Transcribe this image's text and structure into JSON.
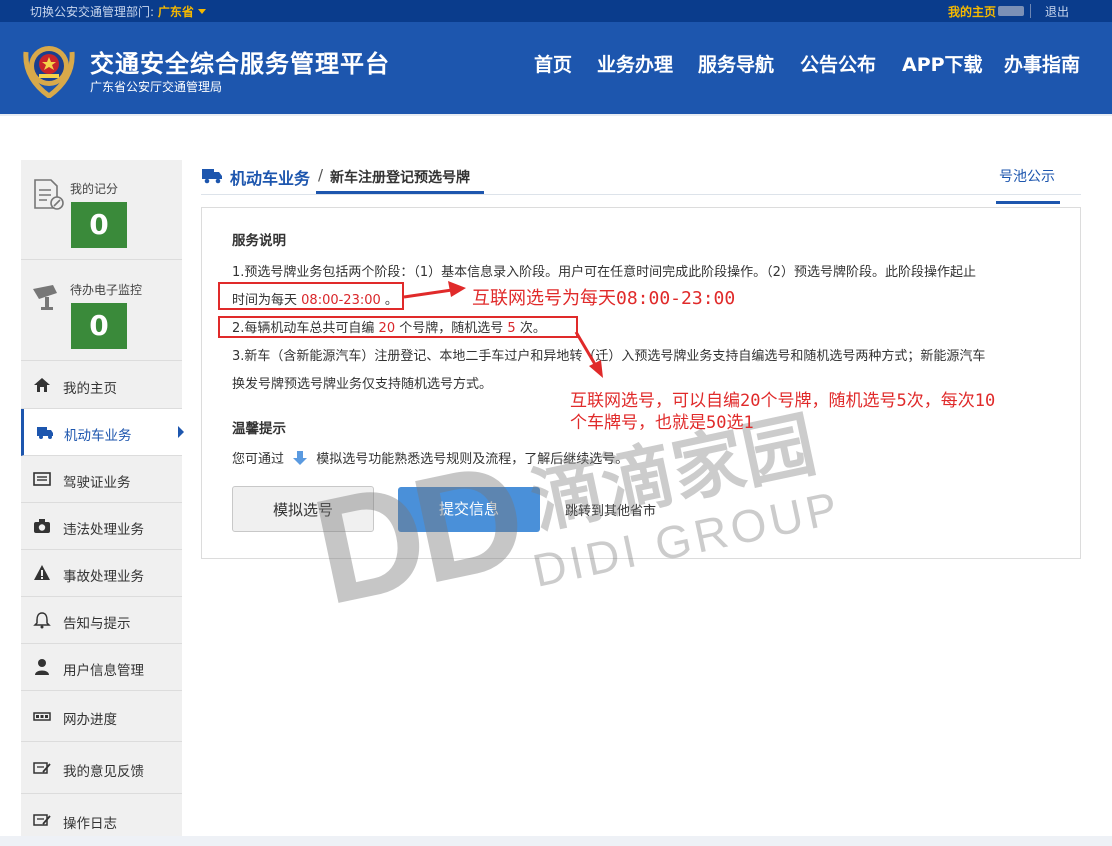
{
  "topbar": {
    "switch_label": "切换公安交通管理部门:",
    "province": "广东省",
    "my_home": "我的主页",
    "logout": "退出"
  },
  "header": {
    "title": "交通安全综合服务管理平台",
    "subtitle": "广东省公安厅交通管理局",
    "nav": [
      "首页",
      "业务办理",
      "服务导航",
      "公告公布",
      "APP下载",
      "办事指南"
    ]
  },
  "sidebar": {
    "score_label": "我的记分",
    "score_value": "0",
    "monitor_label": "待办电子监控",
    "monitor_value": "0",
    "items": [
      {
        "label": "我的主页",
        "icon": "home-icon"
      },
      {
        "label": "机动车业务",
        "icon": "truck-icon",
        "active": true
      },
      {
        "label": "驾驶证业务",
        "icon": "license-card-icon"
      },
      {
        "label": "违法处理业务",
        "icon": "camera-icon"
      },
      {
        "label": "事故处理业务",
        "icon": "warning-icon"
      },
      {
        "label": "告知与提示",
        "icon": "bell-icon"
      },
      {
        "label": "用户信息管理",
        "icon": "user-icon"
      },
      {
        "label": "网办进度",
        "icon": "progress-icon"
      },
      {
        "label": "我的意见反馈",
        "icon": "feedback-icon"
      },
      {
        "label": "操作日志",
        "icon": "log-icon"
      }
    ]
  },
  "breadcrumb": {
    "section": "机动车业务",
    "separator": "/",
    "page": "新车注册登记预选号牌",
    "pool_link": "号池公示"
  },
  "service": {
    "heading": "服务说明",
    "line1": "1.预选号牌业务包括两个阶段：（1）基本信息录入阶段。用户可在任意时间完成此阶段操作。（2）预选号牌阶段。此阶段操作起止",
    "line2_prefix": "时间为每天",
    "line2_time": "08:00-23:00",
    "line2_suffix": "。",
    "line3_prefix": "2.每辆机动车总共可自编",
    "line3_num1": "20",
    "line3_mid": "个号牌，随机选号",
    "line3_num2": "5",
    "line3_suffix": "次。",
    "line4": "3.新车（含新能源汽车）注册登记、本地二手车过户和异地转（迁）入预选号牌业务支持自编选号和随机选号两种方式；新能源汽车",
    "line5": "换发号牌预选号牌业务仅支持随机选号方式。"
  },
  "tips": {
    "heading": "温馨提示",
    "prefix": "您可通过",
    "suffix": "模拟选号功能熟悉选号规则及流程，了解后继续选号。"
  },
  "buttons": {
    "simulate": "模拟选号",
    "submit": "提交信息",
    "jump": "跳转到其他省市"
  },
  "annotations": {
    "note1": "互联网选号为每天08:00-23:00",
    "note2_line1": "互联网选号，可以自编20个号牌，随机选号5次，每次10",
    "note2_line2": "个车牌号，也就是50选1"
  },
  "watermark": {
    "logo": "DD",
    "cn": "滴滴家园",
    "en": "DIDI GROUP"
  },
  "colors": {
    "header_blue": "#1d56ae",
    "accent_yellow": "#f5b800",
    "score_green": "#3a8a3a",
    "annotation_red": "#e02a2a"
  }
}
